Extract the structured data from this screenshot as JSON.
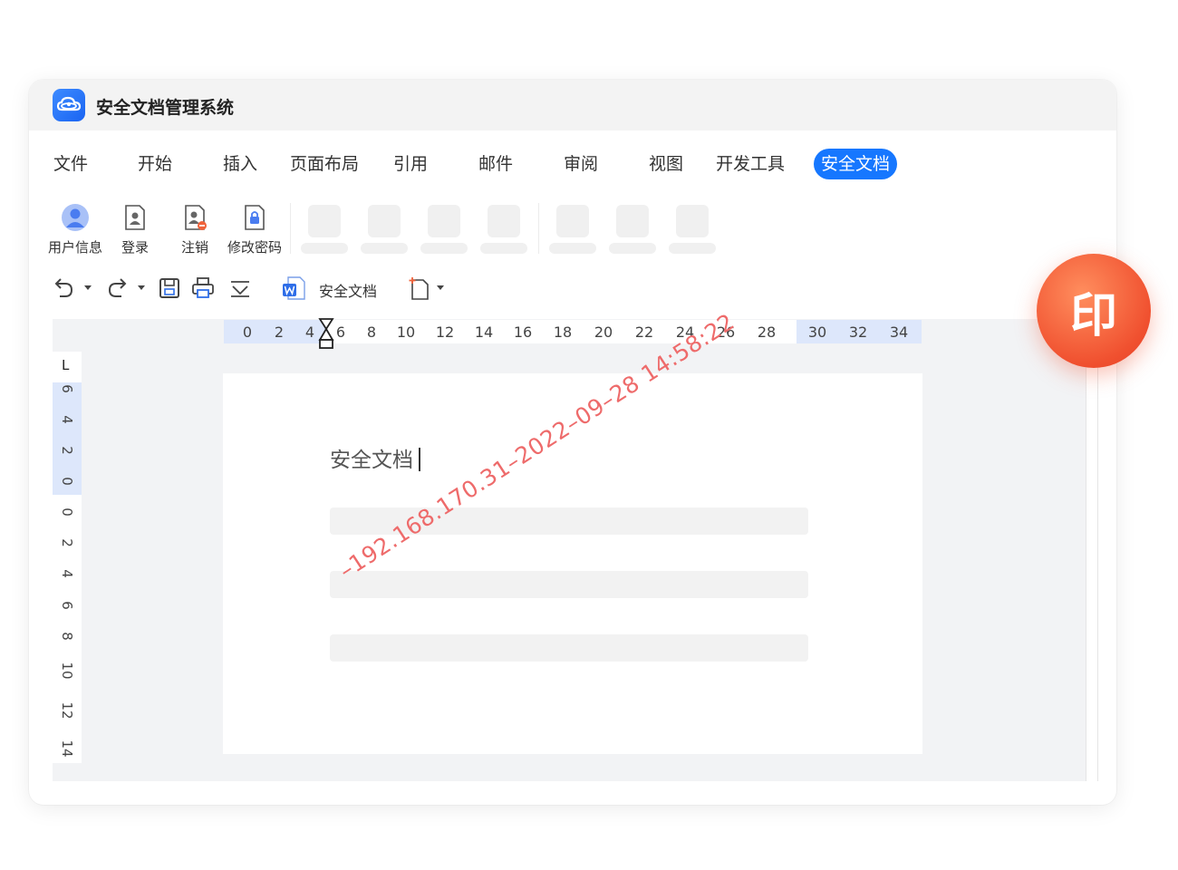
{
  "app": {
    "title": "安全文档管理系统",
    "logo_icon": "cloud-logo-icon"
  },
  "menu": {
    "items": [
      {
        "label": "文件"
      },
      {
        "label": "开始"
      },
      {
        "label": "插入"
      },
      {
        "label": "页面布局"
      },
      {
        "label": "引用"
      },
      {
        "label": "邮件"
      },
      {
        "label": "审阅"
      },
      {
        "label": "视图"
      },
      {
        "label": "开发工具"
      },
      {
        "label": "安全文档"
      }
    ],
    "active_label": "安全文档",
    "active_color": "#1677ff"
  },
  "ribbon": {
    "user_info": "用户信息",
    "login": "登录",
    "logout": "注销",
    "change_password": "修改密码"
  },
  "quickbar": {
    "secure_doc_label": "安全文档"
  },
  "ruler": {
    "horizontal_ticks": [
      "0",
      "2",
      "4",
      "6",
      "8",
      "10",
      "12",
      "14",
      "16",
      "18",
      "20",
      "22",
      "24",
      "26",
      "28",
      "30",
      "32",
      "34"
    ],
    "vertical_top_ticks": [
      "6",
      "4",
      "2",
      "0"
    ],
    "vertical_bottom_ticks": [
      "0",
      "2",
      "4",
      "6",
      "8",
      "10",
      "12",
      "14"
    ],
    "corner": "L"
  },
  "document": {
    "heading": "安全文档",
    "watermark": "–192.168.170.31–2022–09–28  14:58:22",
    "watermark_color": "#ee6b6b"
  },
  "badge": {
    "label": "印",
    "color": "#f0502f"
  }
}
